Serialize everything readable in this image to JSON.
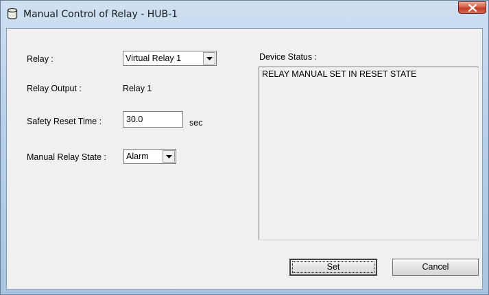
{
  "window": {
    "title": "Manual Control of Relay - HUB-1",
    "icon": "cylinder-icon",
    "close_icon": "close-x-icon"
  },
  "form": {
    "relay_label": "Relay :",
    "relay_value": "Virtual Relay 1",
    "relay_output_label": "Relay Output :",
    "relay_output_value": "Relay 1",
    "safety_reset_label": "Safety Reset Time :",
    "safety_reset_value": "30.0",
    "safety_reset_unit": "sec",
    "manual_state_label": "Manual Relay State :",
    "manual_state_value": "Alarm"
  },
  "status": {
    "label": "Device Status :",
    "text": "RELAY MANUAL SET IN RESET STATE"
  },
  "buttons": {
    "set": "Set",
    "cancel": "Cancel"
  },
  "colors": {
    "title_bar": "#b9d1ea",
    "dialog_bg": "#f0f0f0",
    "close_button": "#c8432b"
  }
}
